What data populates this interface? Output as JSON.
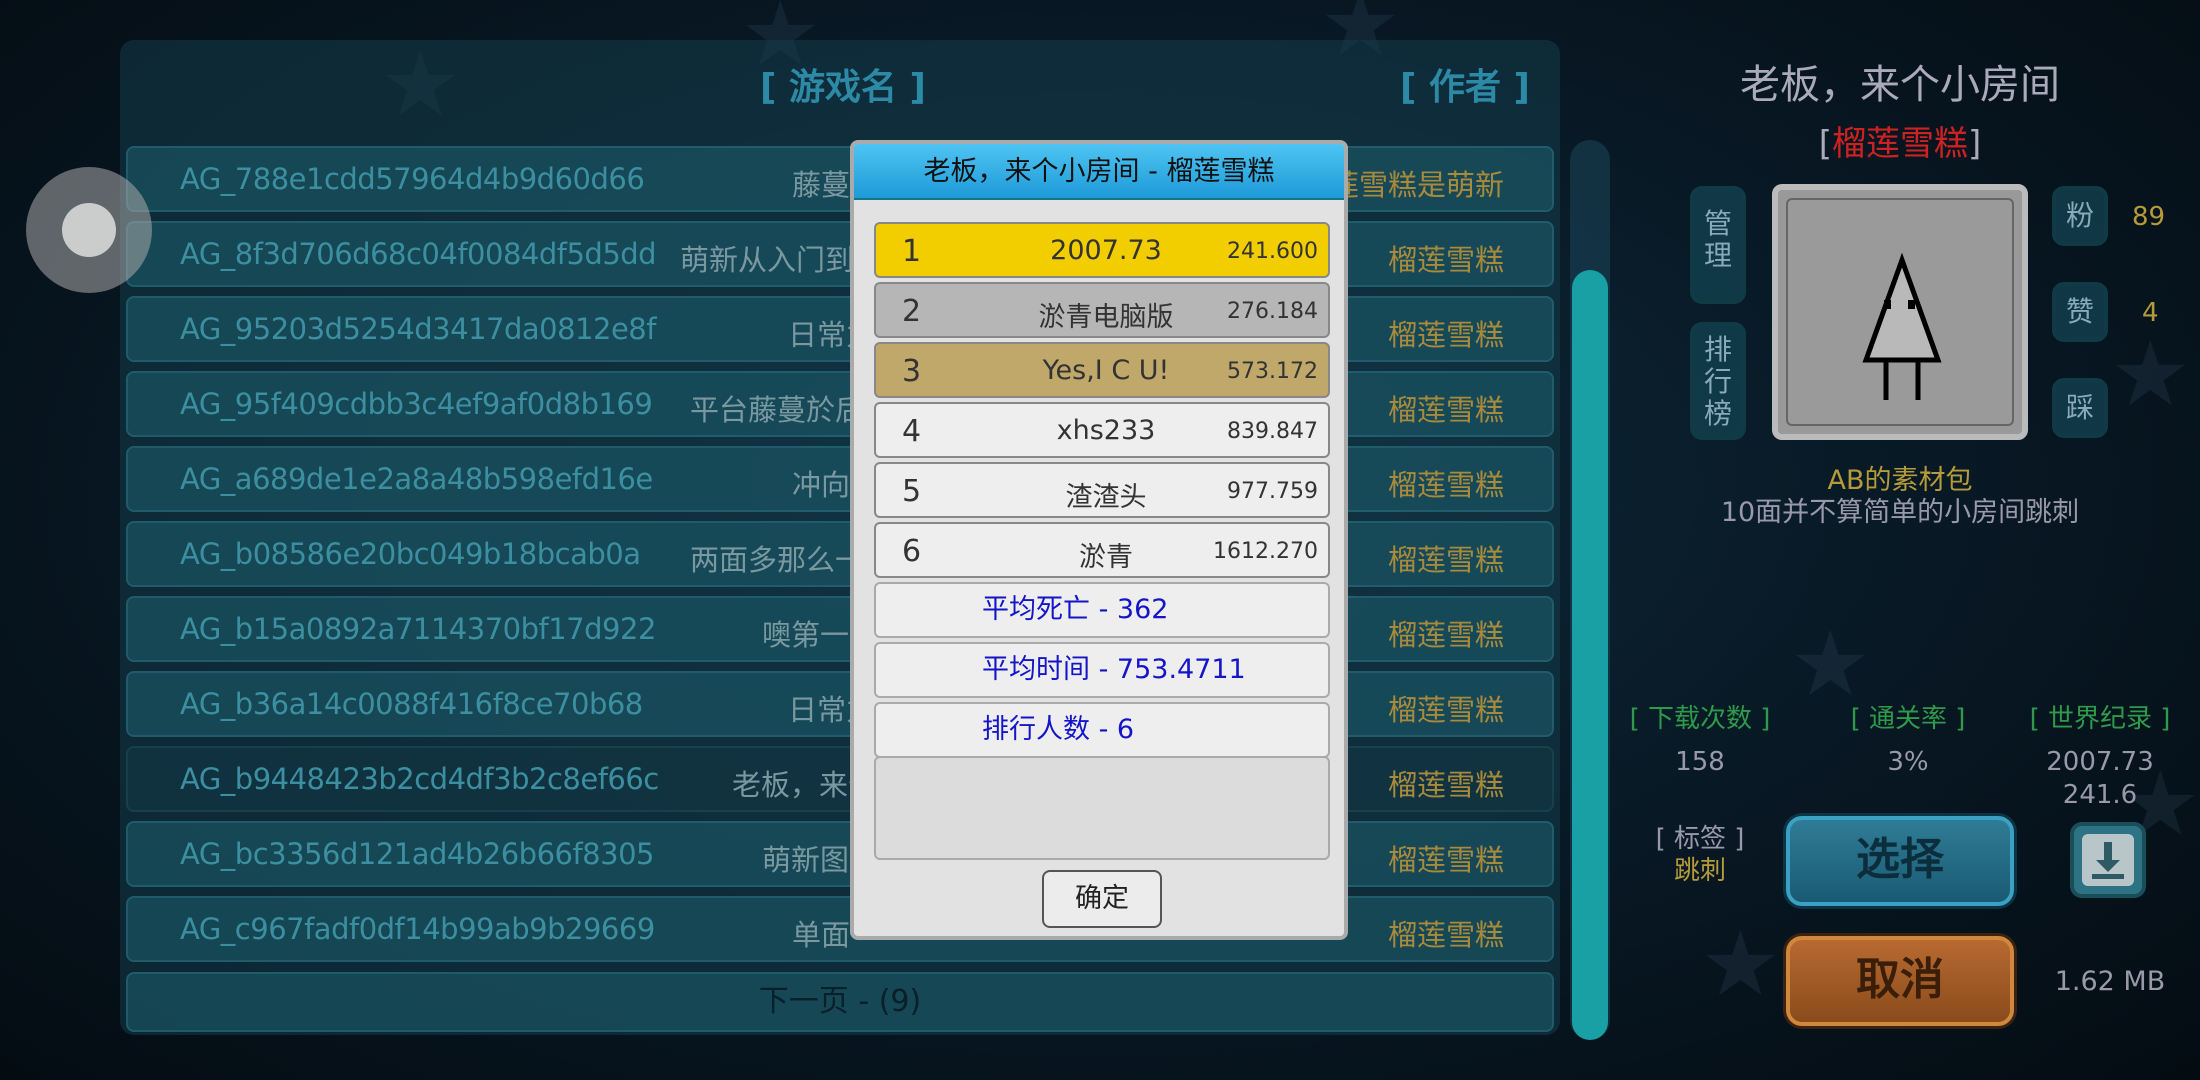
{
  "list": {
    "header_game": "[ 游戏名 ]",
    "header_author": "[ 作者 ]",
    "rows": [
      {
        "id": "AG_788e1cdd57964d4b9d60d66",
        "name": "藤蔓",
        "author": "莲雪糕是萌新"
      },
      {
        "id": "AG_8f3d706d68c04f0084df5d5dd",
        "name": "萌新从入门到",
        "author": "榴莲雪糕"
      },
      {
        "id": "AG_95203d5254d3417da0812e8f",
        "name": "日常力",
        "author": "榴莲雪糕"
      },
      {
        "id": "AG_95f409cdbb3c4ef9af0d8b169",
        "name": "平台藤蔓於后",
        "author": "榴莲雪糕"
      },
      {
        "id": "AG_a689de1e2a8a48b598efd16e",
        "name": "冲向",
        "author": "榴莲雪糕"
      },
      {
        "id": "AG_b08586e20bc049b18bcab0a",
        "name": "两面多那么一",
        "author": "榴莲雪糕"
      },
      {
        "id": "AG_b15a0892a7114370bf17d922",
        "name": "噢第一次",
        "author": "榴莲雪糕"
      },
      {
        "id": "AG_b36a14c0088f416f8ce70b68",
        "name": "日常力",
        "author": "榴莲雪糕"
      },
      {
        "id": "AG_b9448423b2cd4df3b2c8ef66c",
        "name": "老板，来个",
        "author": "榴莲雪糕"
      },
      {
        "id": "AG_bc3356d121ad4b26b66f8305",
        "name": "萌新图",
        "author": "榴莲雪糕"
      },
      {
        "id": "AG_c967fadf0df14b99ab9b29669",
        "name": "单面",
        "author": "榴莲雪糕"
      }
    ],
    "next_page": "下一页 - (9)"
  },
  "detail": {
    "title": "老板，来个小房间",
    "author_open": "[",
    "author": "榴莲雪糕",
    "author_close": "]",
    "manage_label": "管理",
    "rank_label": "排行榜",
    "fans_label": "粉",
    "fans_count": "89",
    "like_label": "赞",
    "like_count": "4",
    "dislike_label": "踩",
    "desc_line1": "AB的素材包",
    "desc_line2": "10面并不算简单的小房间跳刺",
    "downloads_header": "[ 下载次数 ]",
    "downloads_value": "158",
    "clear_rate_header": "[ 通关率 ]",
    "clear_rate_value": "3%",
    "world_record_header": "[ 世界纪录 ]",
    "world_record_name": "2007.73",
    "world_record_time": "241.6",
    "tag_header": "[ 标签 ]",
    "tag_value": "跳刺",
    "select_label": "选择",
    "cancel_label": "取消",
    "file_size": "1.62 MB"
  },
  "modal": {
    "title": "老板，来个小房间 - 榴莲雪糕",
    "entries": [
      {
        "rank": "1",
        "name": "2007.73",
        "time": "241.600",
        "color": "#f2ce00"
      },
      {
        "rank": "2",
        "name": "淤青电脑版",
        "time": "276.184",
        "color": "#b6b6b6"
      },
      {
        "rank": "3",
        "name": "Yes,I C U!",
        "time": "573.172",
        "color": "#bfa86a"
      },
      {
        "rank": "4",
        "name": "xhs233",
        "time": "839.847",
        "color": "#eeeeee"
      },
      {
        "rank": "5",
        "name": "渣渣头",
        "time": "977.759",
        "color": "#eeeeee"
      },
      {
        "rank": "6",
        "name": "淤青",
        "time": "1612.270",
        "color": "#eeeeee"
      }
    ],
    "avg_deaths": "平均死亡 - 362",
    "avg_time": "平均时间 - 753.4711",
    "player_count": "排行人数 - 6",
    "ok_label": "确定"
  }
}
